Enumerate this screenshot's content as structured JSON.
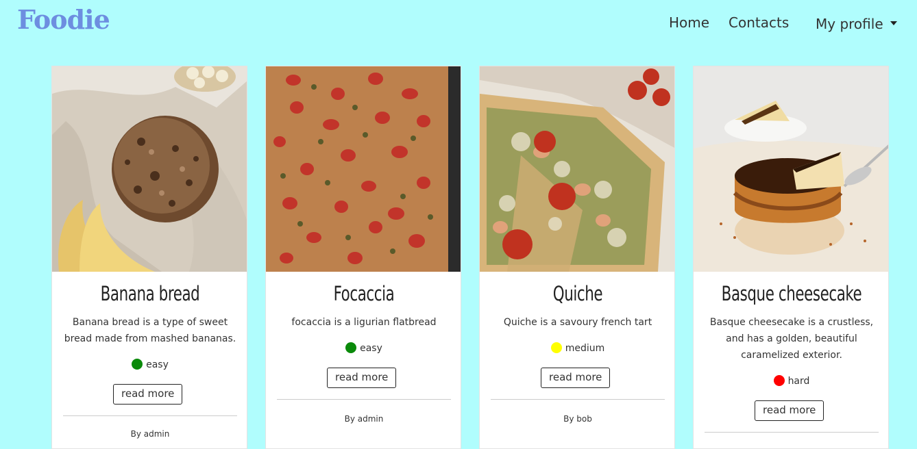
{
  "nav": {
    "brand": "Foodie",
    "home": "Home",
    "contacts": "Contacts",
    "profile": "My profile"
  },
  "colors": {
    "background": "#b0fdfd",
    "brand": "#6d8ee0",
    "easy": "#0a8a0a",
    "medium": "#ffff00",
    "hard": "#ff0000"
  },
  "cards": [
    {
      "title": "Banana bread",
      "description": "Banana bread is a type of sweet bread made from mashed bananas.",
      "difficulty": "easy",
      "button": "read more",
      "author": "By admin"
    },
    {
      "title": "Focaccia",
      "description": "focaccia is a ligurian flatbread",
      "difficulty": "easy",
      "button": "read more",
      "author": "By admin"
    },
    {
      "title": "Quiche",
      "description": "Quiche is a savoury french tart",
      "difficulty": "medium",
      "button": "read more",
      "author": "By bob"
    },
    {
      "title": "Basque cheesecake",
      "description": "Basque cheesecake is a crustless, and has a golden, beautiful caramelized exterior.",
      "difficulty": "hard",
      "button": "read more",
      "author": ""
    }
  ]
}
